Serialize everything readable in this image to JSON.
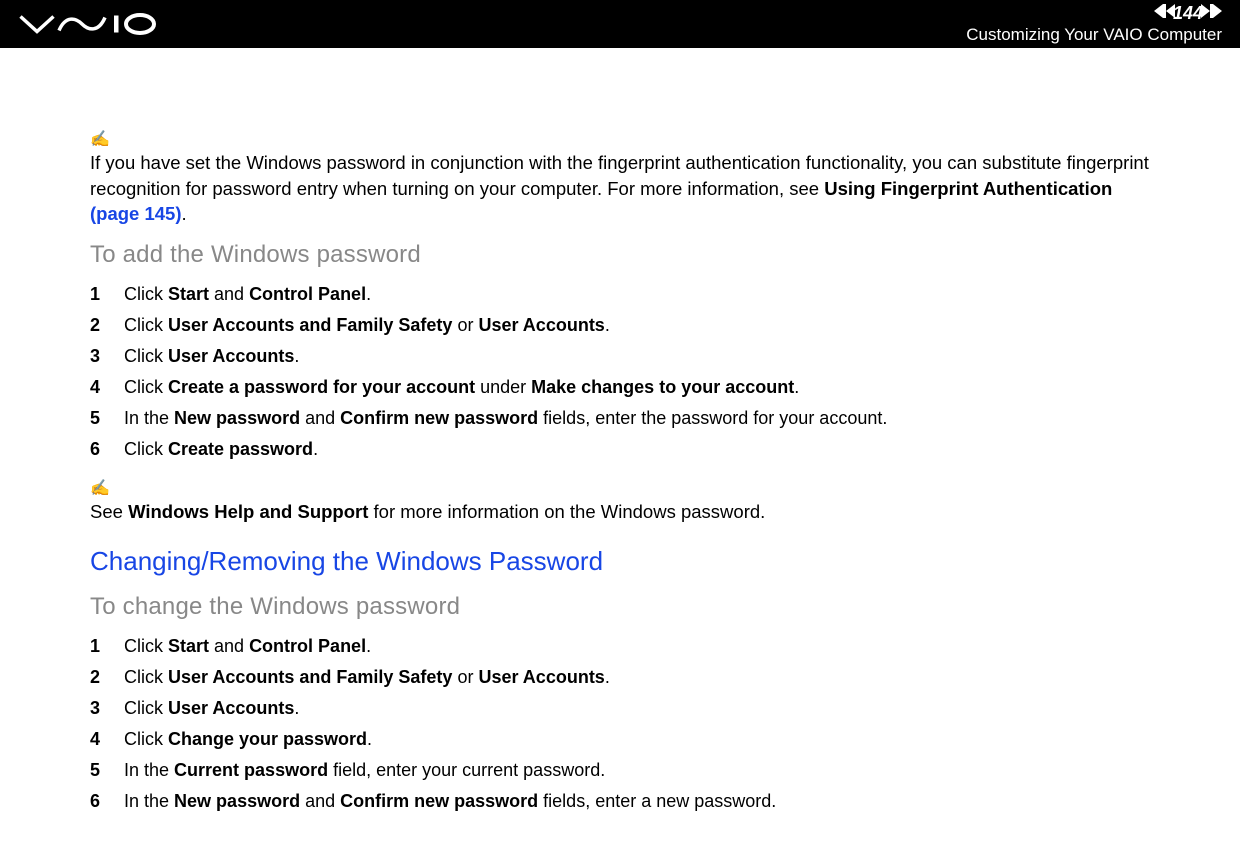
{
  "header": {
    "page_number": "144",
    "section_title": "Customizing Your VAIO Computer"
  },
  "note1": {
    "parts": [
      {
        "t": "If you have set the Windows password in conjunction with the fingerprint authentication functionality, you can substitute fingerprint recognition for password entry when turning on your computer. For more information, see "
      },
      {
        "t": "Using Fingerprint Authentication ",
        "b": true
      },
      {
        "t": "(page 145)",
        "link": true
      },
      {
        "t": "."
      }
    ]
  },
  "heading1": "To add the Windows password",
  "steps1": [
    {
      "n": "1",
      "parts": [
        {
          "t": "Click "
        },
        {
          "t": "Start",
          "b": true
        },
        {
          "t": " and "
        },
        {
          "t": "Control Panel",
          "b": true
        },
        {
          "t": "."
        }
      ]
    },
    {
      "n": "2",
      "parts": [
        {
          "t": "Click "
        },
        {
          "t": "User Accounts and Family Safety",
          "b": true
        },
        {
          "t": " or "
        },
        {
          "t": "User Accounts",
          "b": true
        },
        {
          "t": "."
        }
      ]
    },
    {
      "n": "3",
      "parts": [
        {
          "t": "Click "
        },
        {
          "t": "User Accounts",
          "b": true
        },
        {
          "t": "."
        }
      ]
    },
    {
      "n": "4",
      "parts": [
        {
          "t": "Click "
        },
        {
          "t": "Create a password for your account",
          "b": true
        },
        {
          "t": " under "
        },
        {
          "t": "Make changes to your account",
          "b": true
        },
        {
          "t": "."
        }
      ]
    },
    {
      "n": "5",
      "parts": [
        {
          "t": "In the "
        },
        {
          "t": "New password",
          "b": true
        },
        {
          "t": " and "
        },
        {
          "t": "Confirm new password",
          "b": true
        },
        {
          "t": " fields, enter the password for your account."
        }
      ]
    },
    {
      "n": "6",
      "parts": [
        {
          "t": "Click "
        },
        {
          "t": "Create password",
          "b": true
        },
        {
          "t": "."
        }
      ]
    }
  ],
  "note2": {
    "parts": [
      {
        "t": "See "
      },
      {
        "t": "Windows Help and Support",
        "b": true
      },
      {
        "t": " for more information on the Windows password."
      }
    ]
  },
  "heading2": "Changing/Removing the Windows Password",
  "heading3": "To change the Windows password",
  "steps2": [
    {
      "n": "1",
      "parts": [
        {
          "t": "Click "
        },
        {
          "t": "Start",
          "b": true
        },
        {
          "t": " and "
        },
        {
          "t": "Control Panel",
          "b": true
        },
        {
          "t": "."
        }
      ]
    },
    {
      "n": "2",
      "parts": [
        {
          "t": "Click "
        },
        {
          "t": "User Accounts and Family Safety",
          "b": true
        },
        {
          "t": " or "
        },
        {
          "t": "User Accounts",
          "b": true
        },
        {
          "t": "."
        }
      ]
    },
    {
      "n": "3",
      "parts": [
        {
          "t": "Click "
        },
        {
          "t": "User Accounts",
          "b": true
        },
        {
          "t": "."
        }
      ]
    },
    {
      "n": "4",
      "parts": [
        {
          "t": "Click "
        },
        {
          "t": "Change your password",
          "b": true
        },
        {
          "t": "."
        }
      ]
    },
    {
      "n": "5",
      "parts": [
        {
          "t": "In the "
        },
        {
          "t": "Current password",
          "b": true
        },
        {
          "t": " field, enter your current password."
        }
      ]
    },
    {
      "n": "6",
      "parts": [
        {
          "t": "In the "
        },
        {
          "t": "New password",
          "b": true
        },
        {
          "t": " and "
        },
        {
          "t": "Confirm new password",
          "b": true
        },
        {
          "t": " fields, enter a new password."
        }
      ]
    }
  ]
}
